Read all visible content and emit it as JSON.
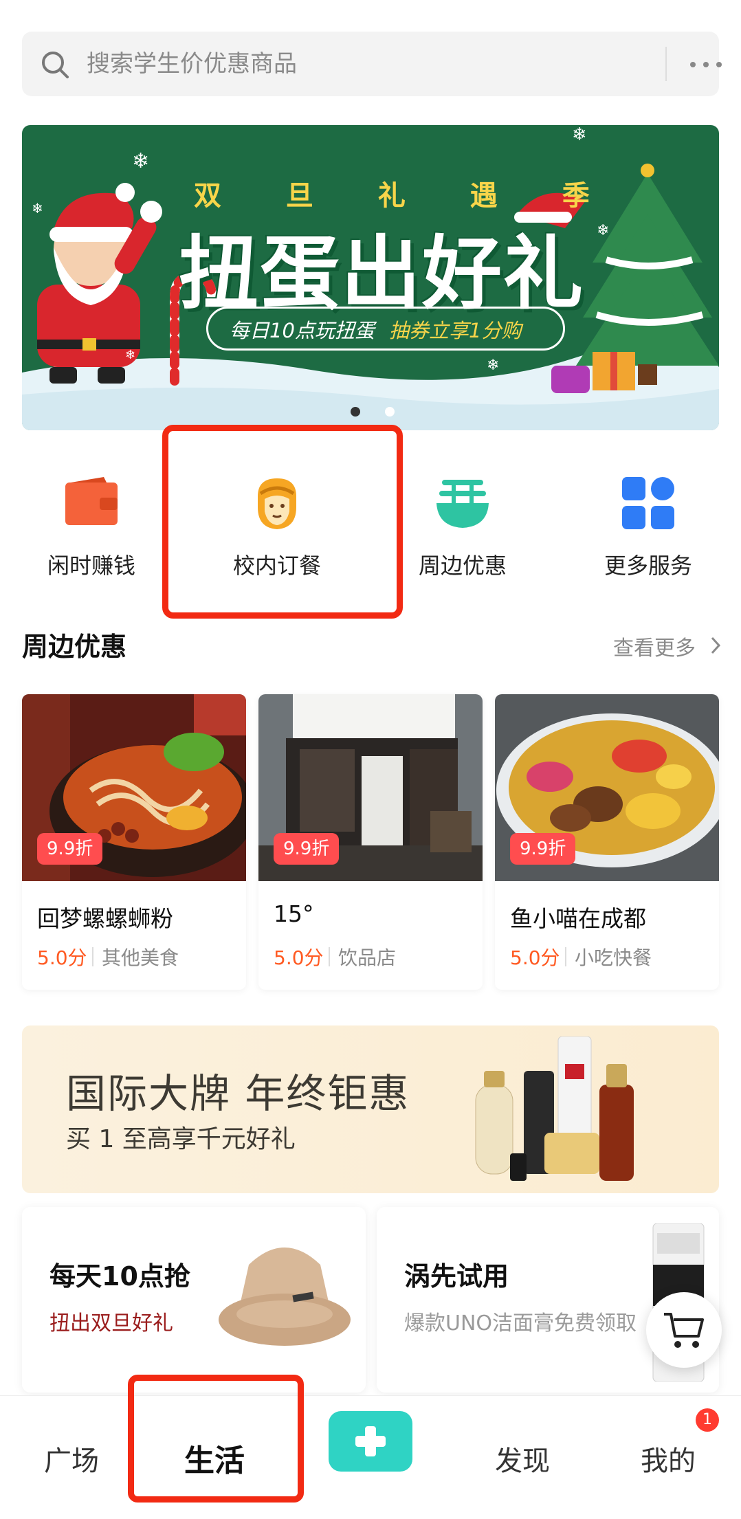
{
  "search": {
    "placeholder": "搜索学生价优惠商品"
  },
  "banner": {
    "subtitle": "双 旦 礼 遇 季",
    "title": "扭蛋出好礼",
    "pill_left": "每日10点玩扭蛋",
    "pill_right": "抽券立享1分购",
    "page_index": 1,
    "page_count": 2
  },
  "services": [
    {
      "label": "闲时赚钱",
      "icon": "wallet-icon",
      "color": "#f4623a"
    },
    {
      "label": "校内订餐",
      "icon": "monkey-king-icon",
      "color": "#f6a623"
    },
    {
      "label": "周边优惠",
      "icon": "noodle-bowl-icon",
      "color": "#2ec4a2"
    },
    {
      "label": "更多服务",
      "icon": "grid-apps-icon",
      "color": "#2f7cf6"
    }
  ],
  "nearby": {
    "title": "周边优惠",
    "more_label": "查看更多",
    "items": [
      {
        "discount": "9.9折",
        "name": "回梦螺螺蛳粉",
        "score": "5.0分",
        "category": "其他美食"
      },
      {
        "discount": "9.9折",
        "name": "15°",
        "score": "5.0分",
        "category": "饮品店"
      },
      {
        "discount": "9.9折",
        "name": "鱼小喵在成都",
        "score": "5.0分",
        "category": "小吃快餐"
      }
    ]
  },
  "promo": {
    "title": "国际大牌 年终钜惠",
    "subtitle": "买 1 至高享千元好礼"
  },
  "deals": [
    {
      "title": "每天10点抢",
      "subtitle": "扭出双旦好礼"
    },
    {
      "title": "涡先试用",
      "subtitle": "爆款UNO洁面膏免费领取"
    }
  ],
  "tabs": [
    {
      "label": "广场"
    },
    {
      "label": "生活"
    },
    {
      "label": "发现"
    },
    {
      "label": "我的"
    }
  ],
  "badge_count": "1",
  "colors": {
    "accent_teal": "#2fd3c4",
    "highlight_red": "#f22a13",
    "price_orange": "#ff5a22",
    "banner_green": "#1d6b43"
  }
}
